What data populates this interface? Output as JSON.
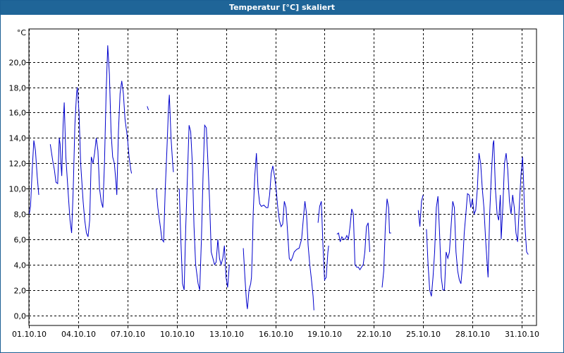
{
  "window": {
    "title": "Temperatur [°C] skaliert"
  },
  "chart_data": {
    "type": "line",
    "title": "Temperatur [°C] skaliert",
    "unit_label": "°C",
    "xlabel": "",
    "ylabel": "",
    "ylim": [
      -0.8,
      22.6
    ],
    "y_ticks": [
      "0,0",
      "2,0",
      "4,0",
      "6,0",
      "8,0",
      "10,0",
      "12,0",
      "14,0",
      "16,0",
      "18,0",
      "20,0"
    ],
    "y_tick_values": [
      0,
      2,
      4,
      6,
      8,
      10,
      12,
      14,
      16,
      18,
      20
    ],
    "x_ticks": [
      "01.10.10",
      "04.10.10",
      "07.10.10",
      "10.10.10",
      "13.10.10",
      "16.10.10",
      "19.10.10",
      "22.10.10",
      "25.10.10",
      "28.10.10",
      "31.10.10"
    ],
    "x_tick_values": [
      0,
      3,
      6,
      9,
      12,
      15,
      18,
      21,
      24,
      27,
      30
    ],
    "xlim": [
      0,
      30.9
    ],
    "grid": true,
    "line_color": "#0000cc",
    "series": [
      {
        "segments": [
          [
            [
              0.02,
              8.0
            ],
            [
              0.1,
              8.6
            ],
            [
              0.2,
              11.5
            ],
            [
              0.3,
              13.8
            ],
            [
              0.4,
              13.0
            ],
            [
              0.5,
              11.0
            ],
            [
              0.6,
              9.5
            ]
          ],
          [
            [
              1.3,
              13.5
            ],
            [
              1.45,
              12.2
            ],
            [
              1.55,
              11.5
            ],
            [
              1.65,
              10.5
            ],
            [
              1.75,
              10.4
            ],
            [
              1.85,
              14.0
            ],
            [
              1.9,
              13.5
            ],
            [
              1.95,
              12.0
            ],
            [
              2.0,
              11.0
            ],
            [
              2.08,
              15.0
            ],
            [
              2.15,
              16.8
            ],
            [
              2.25,
              12.5
            ],
            [
              2.4,
              9.5
            ],
            [
              2.5,
              7.5
            ],
            [
              2.6,
              6.5
            ],
            [
              2.7,
              10.0
            ],
            [
              2.8,
              15.0
            ],
            [
              2.9,
              17.5
            ],
            [
              2.95,
              18.0
            ],
            [
              3.05,
              16.0
            ],
            [
              3.15,
              12.0
            ],
            [
              3.3,
              9.0
            ],
            [
              3.4,
              7.5
            ],
            [
              3.5,
              6.5
            ],
            [
              3.6,
              6.2
            ],
            [
              3.7,
              7.5
            ],
            [
              3.8,
              12.5
            ],
            [
              3.9,
              12.0
            ],
            [
              4.0,
              12.8
            ],
            [
              4.1,
              14.0
            ],
            [
              4.2,
              13.0
            ],
            [
              4.3,
              10.0
            ],
            [
              4.4,
              9.0
            ],
            [
              4.5,
              8.5
            ],
            [
              4.6,
              12.0
            ],
            [
              4.7,
              17.5
            ],
            [
              4.8,
              21.3
            ],
            [
              4.9,
              19.0
            ],
            [
              5.0,
              14.5
            ],
            [
              5.1,
              12.5
            ],
            [
              5.2,
              12.0
            ],
            [
              5.3,
              10.5
            ],
            [
              5.35,
              9.5
            ],
            [
              5.45,
              14.5
            ],
            [
              5.55,
              17.5
            ],
            [
              5.65,
              18.5
            ],
            [
              5.75,
              17.5
            ],
            [
              5.85,
              15.5
            ],
            [
              6.0,
              14.0
            ],
            [
              6.1,
              12.5
            ],
            [
              6.2,
              11.5
            ],
            [
              6.25,
              11.2
            ]
          ],
          [
            [
              7.2,
              16.5
            ],
            [
              7.28,
              16.2
            ]
          ],
          [
            [
              7.75,
              10.0
            ],
            [
              7.85,
              8.5
            ],
            [
              8.0,
              7.0
            ],
            [
              8.1,
              6.0
            ],
            [
              8.2,
              5.8
            ],
            [
              8.3,
              10.0
            ],
            [
              8.4,
              13.0
            ],
            [
              8.5,
              16.5
            ],
            [
              8.55,
              17.4
            ],
            [
              8.65,
              14.0
            ],
            [
              8.75,
              12.0
            ],
            [
              8.8,
              11.3
            ]
          ],
          [
            [
              9.15,
              10.0
            ],
            [
              9.25,
              6.0
            ],
            [
              9.35,
              2.5
            ],
            [
              9.45,
              2.0
            ],
            [
              9.55,
              7.0
            ],
            [
              9.65,
              11.0
            ],
            [
              9.75,
              15.0
            ],
            [
              9.85,
              14.5
            ],
            [
              9.95,
              12.0
            ],
            [
              10.05,
              7.0
            ],
            [
              10.15,
              4.0
            ],
            [
              10.3,
              2.5
            ],
            [
              10.4,
              2.0
            ],
            [
              10.5,
              6.0
            ],
            [
              10.6,
              11.0
            ],
            [
              10.7,
              15.0
            ],
            [
              10.8,
              14.8
            ],
            [
              10.9,
              12.0
            ],
            [
              11.0,
              9.0
            ],
            [
              11.1,
              5.0
            ],
            [
              11.2,
              4.5
            ],
            [
              11.3,
              4.0
            ],
            [
              11.4,
              4.2
            ],
            [
              11.5,
              6.0
            ],
            [
              11.6,
              4.5
            ],
            [
              11.7,
              4.0
            ],
            [
              11.8,
              4.5
            ],
            [
              11.9,
              5.5
            ],
            [
              12.0,
              3.0
            ],
            [
              12.1,
              2.2
            ],
            [
              12.2,
              4.0
            ]
          ],
          [
            [
              13.05,
              5.3
            ],
            [
              13.15,
              3.0
            ],
            [
              13.25,
              1.0
            ],
            [
              13.3,
              0.5
            ],
            [
              13.4,
              2.0
            ],
            [
              13.5,
              2.5
            ],
            [
              13.55,
              3.0
            ],
            [
              13.6,
              5.0
            ],
            [
              13.65,
              8.0
            ],
            [
              13.75,
              11.0
            ],
            [
              13.85,
              12.8
            ],
            [
              13.95,
              10.0
            ],
            [
              14.05,
              8.8
            ],
            [
              14.15,
              8.6
            ],
            [
              14.3,
              8.7
            ],
            [
              14.45,
              8.5
            ],
            [
              14.55,
              8.5
            ],
            [
              14.65,
              9.5
            ],
            [
              14.75,
              11.2
            ],
            [
              14.85,
              11.8
            ],
            [
              14.95,
              11.0
            ],
            [
              15.05,
              10.0
            ],
            [
              15.15,
              8.5
            ],
            [
              15.25,
              7.5
            ],
            [
              15.35,
              7.0
            ],
            [
              15.45,
              7.2
            ],
            [
              15.55,
              9.0
            ],
            [
              15.65,
              8.5
            ],
            [
              15.75,
              6.5
            ],
            [
              15.85,
              4.5
            ],
            [
              15.95,
              4.3
            ],
            [
              16.05,
              4.6
            ],
            [
              16.15,
              5.0
            ],
            [
              16.3,
              5.2
            ],
            [
              16.45,
              5.3
            ],
            [
              16.6,
              6.0
            ],
            [
              16.7,
              7.5
            ],
            [
              16.8,
              9.0
            ],
            [
              16.9,
              8.0
            ],
            [
              17.0,
              5.5
            ],
            [
              17.1,
              4.0
            ],
            [
              17.2,
              2.8
            ],
            [
              17.3,
              1.5
            ],
            [
              17.35,
              0.4
            ]
          ],
          [
            [
              17.6,
              7.3
            ],
            [
              17.7,
              8.6
            ],
            [
              17.8,
              9.0
            ],
            [
              17.9,
              5.5
            ],
            [
              18.0,
              2.8
            ],
            [
              18.1,
              3.0
            ],
            [
              18.2,
              5.0
            ],
            [
              18.25,
              5.5
            ]
          ],
          [
            [
              18.75,
              6.4
            ],
            [
              18.85,
              6.5
            ],
            [
              18.95,
              5.8
            ],
            [
              19.05,
              6.2
            ],
            [
              19.15,
              6.0
            ],
            [
              19.25,
              6.0
            ],
            [
              19.35,
              6.3
            ],
            [
              19.45,
              6.0
            ],
            [
              19.55,
              7.0
            ],
            [
              19.65,
              8.4
            ],
            [
              19.75,
              8.0
            ],
            [
              19.85,
              4.0
            ],
            [
              19.95,
              3.8
            ],
            [
              20.05,
              3.8
            ],
            [
              20.15,
              3.6
            ],
            [
              20.25,
              3.8
            ],
            [
              20.35,
              4.0
            ],
            [
              20.45,
              5.0
            ],
            [
              20.55,
              7.0
            ],
            [
              20.65,
              7.3
            ],
            [
              20.75,
              5.0
            ]
          ],
          [
            [
              21.5,
              2.2
            ],
            [
              21.6,
              3.5
            ],
            [
              21.7,
              7.0
            ],
            [
              21.8,
              9.2
            ],
            [
              21.9,
              8.5
            ],
            [
              21.95,
              6.5
            ],
            [
              22.05,
              6.5
            ]
          ],
          [
            [
              23.7,
              8.3
            ],
            [
              23.8,
              7.0
            ],
            [
              23.9,
              9.0
            ],
            [
              24.0,
              9.5
            ]
          ],
          [
            [
              24.2,
              6.8
            ],
            [
              24.3,
              4.0
            ],
            [
              24.4,
              2.0
            ],
            [
              24.5,
              1.5
            ],
            [
              24.6,
              3.0
            ],
            [
              24.7,
              5.0
            ],
            [
              24.8,
              8.5
            ],
            [
              24.9,
              9.4
            ],
            [
              25.0,
              6.5
            ],
            [
              25.1,
              3.0
            ],
            [
              25.2,
              2.0
            ],
            [
              25.3,
              2.0
            ],
            [
              25.4,
              5.0
            ],
            [
              25.5,
              4.5
            ],
            [
              25.6,
              5.0
            ],
            [
              25.7,
              7.0
            ],
            [
              25.8,
              9.0
            ],
            [
              25.9,
              8.5
            ],
            [
              26.0,
              5.0
            ],
            [
              26.1,
              3.5
            ],
            [
              26.2,
              2.8
            ],
            [
              26.3,
              2.5
            ],
            [
              26.4,
              4.0
            ],
            [
              26.5,
              6.5
            ],
            [
              26.6,
              8.0
            ],
            [
              26.7,
              9.6
            ],
            [
              26.8,
              9.5
            ],
            [
              26.9,
              8.5
            ],
            [
              27.0,
              9.2
            ],
            [
              27.1,
              8.0
            ],
            [
              27.2,
              8.3
            ],
            [
              27.3,
              10.0
            ],
            [
              27.4,
              12.8
            ],
            [
              27.5,
              12.0
            ],
            [
              27.6,
              10.0
            ],
            [
              27.7,
              8.5
            ],
            [
              27.8,
              6.0
            ],
            [
              27.9,
              4.0
            ],
            [
              27.95,
              3.0
            ],
            [
              28.05,
              8.0
            ],
            [
              28.15,
              11.0
            ],
            [
              28.25,
              13.5
            ],
            [
              28.3,
              13.8
            ],
            [
              28.4,
              10.0
            ],
            [
              28.5,
              8.0
            ],
            [
              28.6,
              7.5
            ],
            [
              28.7,
              9.5
            ],
            [
              28.75,
              6.0
            ],
            [
              28.85,
              8.5
            ],
            [
              28.95,
              12.0
            ],
            [
              29.05,
              12.8
            ],
            [
              29.15,
              11.5
            ],
            [
              29.25,
              9.0
            ],
            [
              29.35,
              8.0
            ],
            [
              29.45,
              9.5
            ],
            [
              29.55,
              8.5
            ],
            [
              29.65,
              6.5
            ],
            [
              29.75,
              5.8
            ],
            [
              29.85,
              8.5
            ],
            [
              29.95,
              11.0
            ],
            [
              30.05,
              12.5
            ],
            [
              30.1,
              11.0
            ],
            [
              30.2,
              7.0
            ],
            [
              30.3,
              5.0
            ],
            [
              30.4,
              4.8
            ]
          ]
        ]
      }
    ]
  }
}
